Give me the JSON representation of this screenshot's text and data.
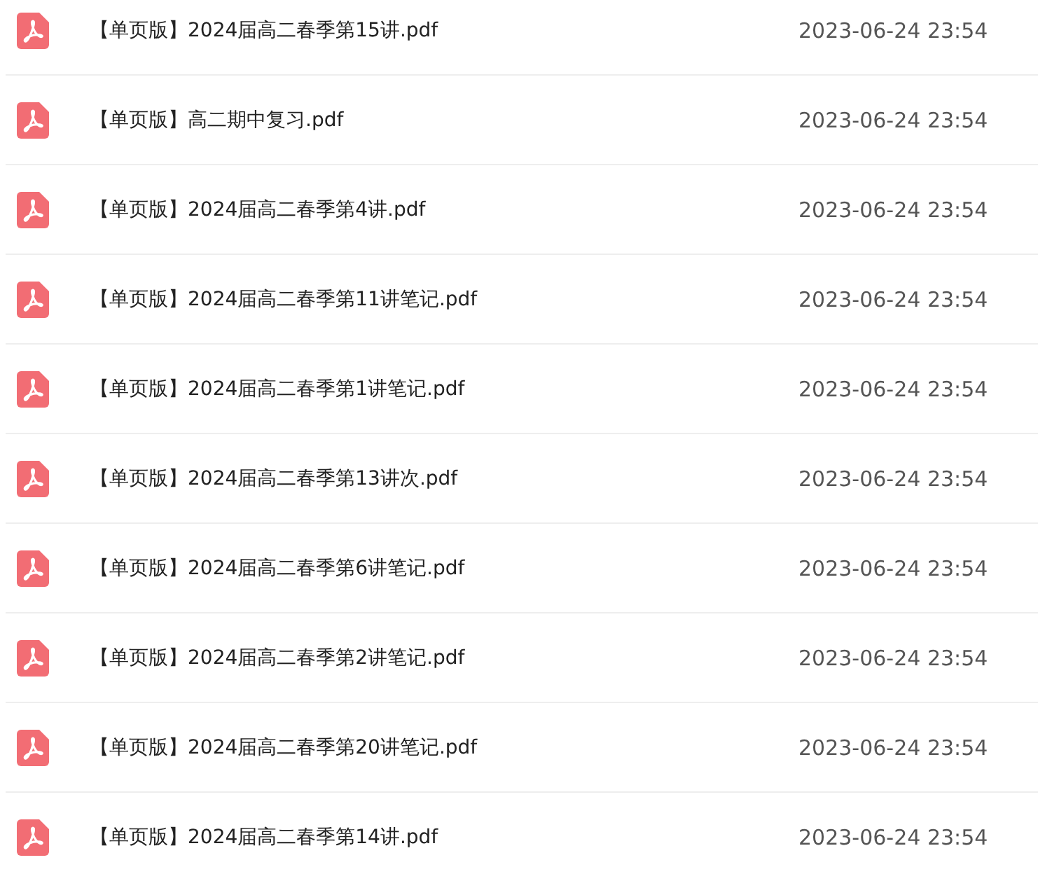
{
  "files": [
    {
      "name": "【单页版】2024届高二春季第15讲.pdf",
      "date": "2023-06-24 23:54"
    },
    {
      "name": "【单页版】高二期中复习.pdf",
      "date": "2023-06-24 23:54"
    },
    {
      "name": "【单页版】2024届高二春季第4讲.pdf",
      "date": "2023-06-24 23:54"
    },
    {
      "name": "【单页版】2024届高二春季第11讲笔记.pdf",
      "date": "2023-06-24 23:54"
    },
    {
      "name": "【单页版】2024届高二春季第1讲笔记.pdf",
      "date": "2023-06-24 23:54"
    },
    {
      "name": "【单页版】2024届高二春季第13讲次.pdf",
      "date": "2023-06-24 23:54"
    },
    {
      "name": "【单页版】2024届高二春季第6讲笔记.pdf",
      "date": "2023-06-24 23:54"
    },
    {
      "name": "【单页版】2024届高二春季第2讲笔记.pdf",
      "date": "2023-06-24 23:54"
    },
    {
      "name": "【单页版】2024届高二春季第20讲笔记.pdf",
      "date": "2023-06-24 23:54"
    },
    {
      "name": "【单页版】2024届高二春季第14讲.pdf",
      "date": "2023-06-24 23:54"
    }
  ]
}
